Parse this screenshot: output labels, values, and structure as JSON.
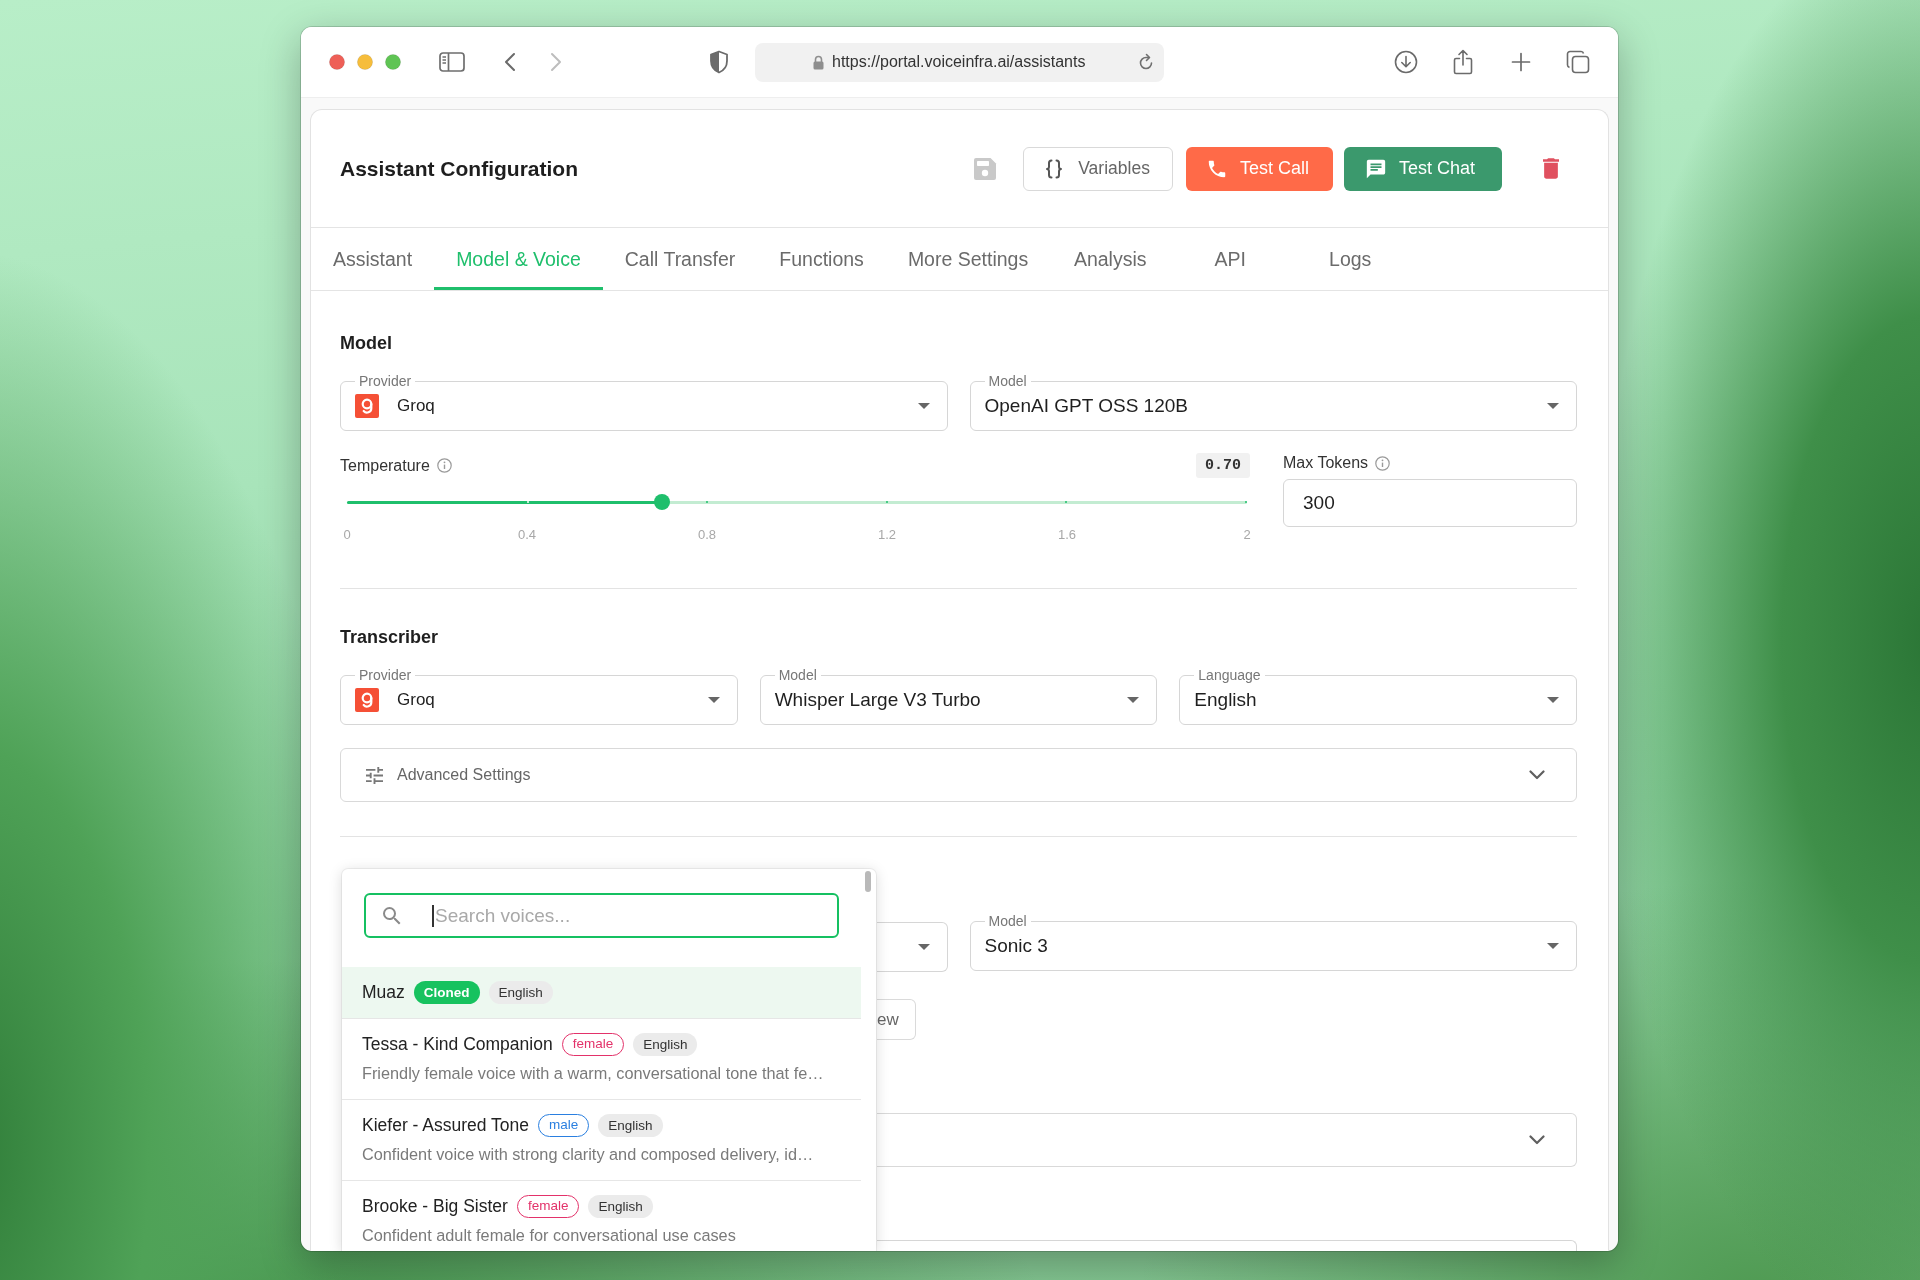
{
  "browser": {
    "url": "https://portal.voiceinfra.ai/assistants"
  },
  "header": {
    "title": "Assistant Configuration",
    "buttons": [
      {
        "kind": "outline",
        "label": "Variables"
      },
      {
        "kind": "call",
        "label": "Test Call"
      },
      {
        "kind": "chat",
        "label": "Test Chat"
      }
    ]
  },
  "tabs": [
    {
      "label": "Assistant",
      "selected": false
    },
    {
      "label": "Model & Voice",
      "selected": true
    },
    {
      "label": "Call Transfer",
      "selected": false
    },
    {
      "label": "Functions",
      "selected": false
    },
    {
      "label": "More Settings",
      "selected": false
    },
    {
      "label": "Analysis",
      "selected": false
    },
    {
      "label": "API",
      "selected": false
    },
    {
      "label": "Logs",
      "selected": false
    }
  ],
  "model_section": {
    "heading": "Model",
    "selects": [
      {
        "kind": "provider",
        "label": "Provider",
        "value": "Groq"
      },
      {
        "kind": "plain",
        "label": "Model",
        "value": "OpenAI GPT OSS 120B"
      }
    ],
    "temperature": {
      "label": "Temperature",
      "reading": "0.70",
      "level": 0.35,
      "marks": [
        "0",
        "0.4",
        "0.8",
        "1.2",
        "1.6",
        "2"
      ]
    },
    "max_tokens": {
      "label": "Max Tokens",
      "value": "300"
    }
  },
  "transcriber_section": {
    "heading": "Transcriber",
    "selects": [
      {
        "kind": "provider",
        "label": "Provider",
        "value": "Groq"
      },
      {
        "kind": "plain",
        "label": "Model",
        "value": "Whisper Large V3 Turbo"
      },
      {
        "kind": "plain",
        "label": "Language",
        "value": "English"
      }
    ],
    "advanced_settings": {
      "label": "Advanced Settings",
      "expanded": false
    }
  },
  "voice_section": {
    "model_select": {
      "label": "Model",
      "value": "Sonic 3"
    },
    "partial_button": {
      "label": "ew"
    },
    "accordion": {
      "expanded": false
    }
  },
  "voice_dropdown": {
    "search": {
      "placeholder": "Search voices...",
      "focused": true
    },
    "voices": [
      {
        "name": "Muaz",
        "selected": true,
        "tags": [
          {
            "kind": "filled",
            "label": "Cloned",
            "color": "#17c25f"
          },
          {
            "kind": "plain",
            "label": "English"
          }
        ]
      },
      {
        "name": "Tessa - Kind Companion",
        "selected": false,
        "tags": [
          {
            "kind": "outline",
            "label": "female",
            "color": "#e3326a"
          },
          {
            "kind": "plain",
            "label": "English"
          }
        ],
        "description": "Friendly female voice with a warm, conversational tone that fe…"
      },
      {
        "name": "Kiefer - Assured Tone",
        "selected": false,
        "tags": [
          {
            "kind": "outline",
            "label": "male",
            "color": "#2a7fe0"
          },
          {
            "kind": "plain",
            "label": "English"
          }
        ],
        "description": "Confident voice with strong clarity and composed delivery, id…"
      },
      {
        "name": "Brooke - Big Sister",
        "selected": false,
        "tags": [
          {
            "kind": "outline",
            "label": "female",
            "color": "#e3326a"
          },
          {
            "kind": "plain",
            "label": "English"
          }
        ],
        "description": "Confident adult female for conversational use cases"
      }
    ]
  }
}
